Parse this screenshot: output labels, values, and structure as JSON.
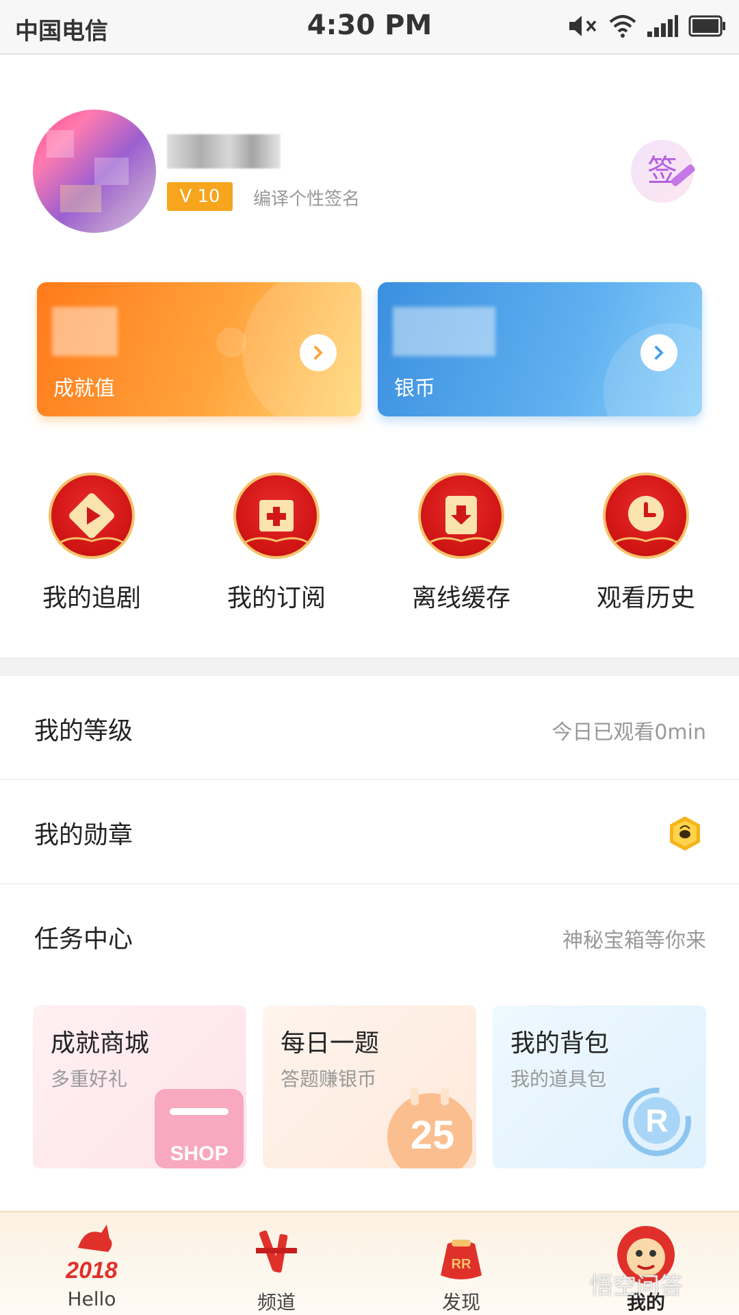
{
  "status_bar": {
    "carrier": "中国电信",
    "time": "4:30 PM",
    "icons": [
      "mute-icon",
      "wifi-icon",
      "signal-icon",
      "battery-icon"
    ]
  },
  "profile": {
    "level": "V 10",
    "signature": "编译个性签名",
    "sign_button": "签"
  },
  "cards": [
    {
      "label": "成就值",
      "color": "#ff8a24"
    },
    {
      "label": "银币",
      "color": "#4aa0e8"
    }
  ],
  "quick_actions": [
    {
      "label": "我的追剧",
      "icon": "play-icon"
    },
    {
      "label": "我的订阅",
      "icon": "subscribe-icon"
    },
    {
      "label": "离线缓存",
      "icon": "download-icon"
    },
    {
      "label": "观看历史",
      "icon": "clock-icon"
    }
  ],
  "list": {
    "level": {
      "title": "我的等级",
      "hint": "今日已观看0min"
    },
    "medal": {
      "title": "我的勋章",
      "icon": "medal-icon"
    },
    "tasks": {
      "title": "任务中心",
      "hint": "神秘宝箱等你来"
    }
  },
  "task_cards": [
    {
      "title": "成就商城",
      "subtitle": "多重好礼",
      "icon": "shop-icon"
    },
    {
      "title": "每日一题",
      "subtitle": "答题赚银币",
      "icon": "calendar-icon",
      "badge": "25"
    },
    {
      "title": "我的背包",
      "subtitle": "我的道具包",
      "icon": "backpack-icon"
    }
  ],
  "bottom_nav": [
    {
      "label": "Hello",
      "icon": "dog-2018-icon",
      "caption": "2018"
    },
    {
      "label": "频道",
      "icon": "firecracker-icon"
    },
    {
      "label": "发现",
      "icon": "lucky-bag-icon"
    },
    {
      "label": "我的",
      "icon": "lion-icon",
      "active": true
    }
  ],
  "watermark": "悟空问答"
}
